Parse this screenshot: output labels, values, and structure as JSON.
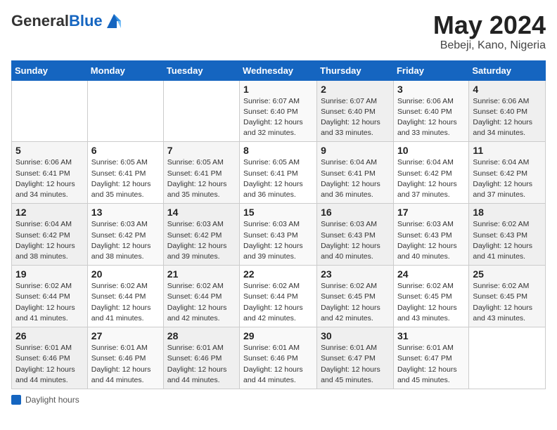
{
  "header": {
    "logo_general": "General",
    "logo_blue": "Blue",
    "month_year": "May 2024",
    "location": "Bebeji, Kano, Nigeria"
  },
  "calendar": {
    "days_of_week": [
      "Sunday",
      "Monday",
      "Tuesday",
      "Wednesday",
      "Thursday",
      "Friday",
      "Saturday"
    ],
    "weeks": [
      [
        {
          "day": "",
          "info": ""
        },
        {
          "day": "",
          "info": ""
        },
        {
          "day": "",
          "info": ""
        },
        {
          "day": "1",
          "info": "Sunrise: 6:07 AM\nSunset: 6:40 PM\nDaylight: 12 hours\nand 32 minutes."
        },
        {
          "day": "2",
          "info": "Sunrise: 6:07 AM\nSunset: 6:40 PM\nDaylight: 12 hours\nand 33 minutes."
        },
        {
          "day": "3",
          "info": "Sunrise: 6:06 AM\nSunset: 6:40 PM\nDaylight: 12 hours\nand 33 minutes."
        },
        {
          "day": "4",
          "info": "Sunrise: 6:06 AM\nSunset: 6:40 PM\nDaylight: 12 hours\nand 34 minutes."
        }
      ],
      [
        {
          "day": "5",
          "info": "Sunrise: 6:06 AM\nSunset: 6:41 PM\nDaylight: 12 hours\nand 34 minutes."
        },
        {
          "day": "6",
          "info": "Sunrise: 6:05 AM\nSunset: 6:41 PM\nDaylight: 12 hours\nand 35 minutes."
        },
        {
          "day": "7",
          "info": "Sunrise: 6:05 AM\nSunset: 6:41 PM\nDaylight: 12 hours\nand 35 minutes."
        },
        {
          "day": "8",
          "info": "Sunrise: 6:05 AM\nSunset: 6:41 PM\nDaylight: 12 hours\nand 36 minutes."
        },
        {
          "day": "9",
          "info": "Sunrise: 6:04 AM\nSunset: 6:41 PM\nDaylight: 12 hours\nand 36 minutes."
        },
        {
          "day": "10",
          "info": "Sunrise: 6:04 AM\nSunset: 6:42 PM\nDaylight: 12 hours\nand 37 minutes."
        },
        {
          "day": "11",
          "info": "Sunrise: 6:04 AM\nSunset: 6:42 PM\nDaylight: 12 hours\nand 37 minutes."
        }
      ],
      [
        {
          "day": "12",
          "info": "Sunrise: 6:04 AM\nSunset: 6:42 PM\nDaylight: 12 hours\nand 38 minutes."
        },
        {
          "day": "13",
          "info": "Sunrise: 6:03 AM\nSunset: 6:42 PM\nDaylight: 12 hours\nand 38 minutes."
        },
        {
          "day": "14",
          "info": "Sunrise: 6:03 AM\nSunset: 6:42 PM\nDaylight: 12 hours\nand 39 minutes."
        },
        {
          "day": "15",
          "info": "Sunrise: 6:03 AM\nSunset: 6:43 PM\nDaylight: 12 hours\nand 39 minutes."
        },
        {
          "day": "16",
          "info": "Sunrise: 6:03 AM\nSunset: 6:43 PM\nDaylight: 12 hours\nand 40 minutes."
        },
        {
          "day": "17",
          "info": "Sunrise: 6:03 AM\nSunset: 6:43 PM\nDaylight: 12 hours\nand 40 minutes."
        },
        {
          "day": "18",
          "info": "Sunrise: 6:02 AM\nSunset: 6:43 PM\nDaylight: 12 hours\nand 41 minutes."
        }
      ],
      [
        {
          "day": "19",
          "info": "Sunrise: 6:02 AM\nSunset: 6:44 PM\nDaylight: 12 hours\nand 41 minutes."
        },
        {
          "day": "20",
          "info": "Sunrise: 6:02 AM\nSunset: 6:44 PM\nDaylight: 12 hours\nand 41 minutes."
        },
        {
          "day": "21",
          "info": "Sunrise: 6:02 AM\nSunset: 6:44 PM\nDaylight: 12 hours\nand 42 minutes."
        },
        {
          "day": "22",
          "info": "Sunrise: 6:02 AM\nSunset: 6:44 PM\nDaylight: 12 hours\nand 42 minutes."
        },
        {
          "day": "23",
          "info": "Sunrise: 6:02 AM\nSunset: 6:45 PM\nDaylight: 12 hours\nand 42 minutes."
        },
        {
          "day": "24",
          "info": "Sunrise: 6:02 AM\nSunset: 6:45 PM\nDaylight: 12 hours\nand 43 minutes."
        },
        {
          "day": "25",
          "info": "Sunrise: 6:02 AM\nSunset: 6:45 PM\nDaylight: 12 hours\nand 43 minutes."
        }
      ],
      [
        {
          "day": "26",
          "info": "Sunrise: 6:01 AM\nSunset: 6:46 PM\nDaylight: 12 hours\nand 44 minutes."
        },
        {
          "day": "27",
          "info": "Sunrise: 6:01 AM\nSunset: 6:46 PM\nDaylight: 12 hours\nand 44 minutes."
        },
        {
          "day": "28",
          "info": "Sunrise: 6:01 AM\nSunset: 6:46 PM\nDaylight: 12 hours\nand 44 minutes."
        },
        {
          "day": "29",
          "info": "Sunrise: 6:01 AM\nSunset: 6:46 PM\nDaylight: 12 hours\nand 44 minutes."
        },
        {
          "day": "30",
          "info": "Sunrise: 6:01 AM\nSunset: 6:47 PM\nDaylight: 12 hours\nand 45 minutes."
        },
        {
          "day": "31",
          "info": "Sunrise: 6:01 AM\nSunset: 6:47 PM\nDaylight: 12 hours\nand 45 minutes."
        },
        {
          "day": "",
          "info": ""
        }
      ]
    ]
  },
  "footer": {
    "label": "Daylight hours"
  }
}
